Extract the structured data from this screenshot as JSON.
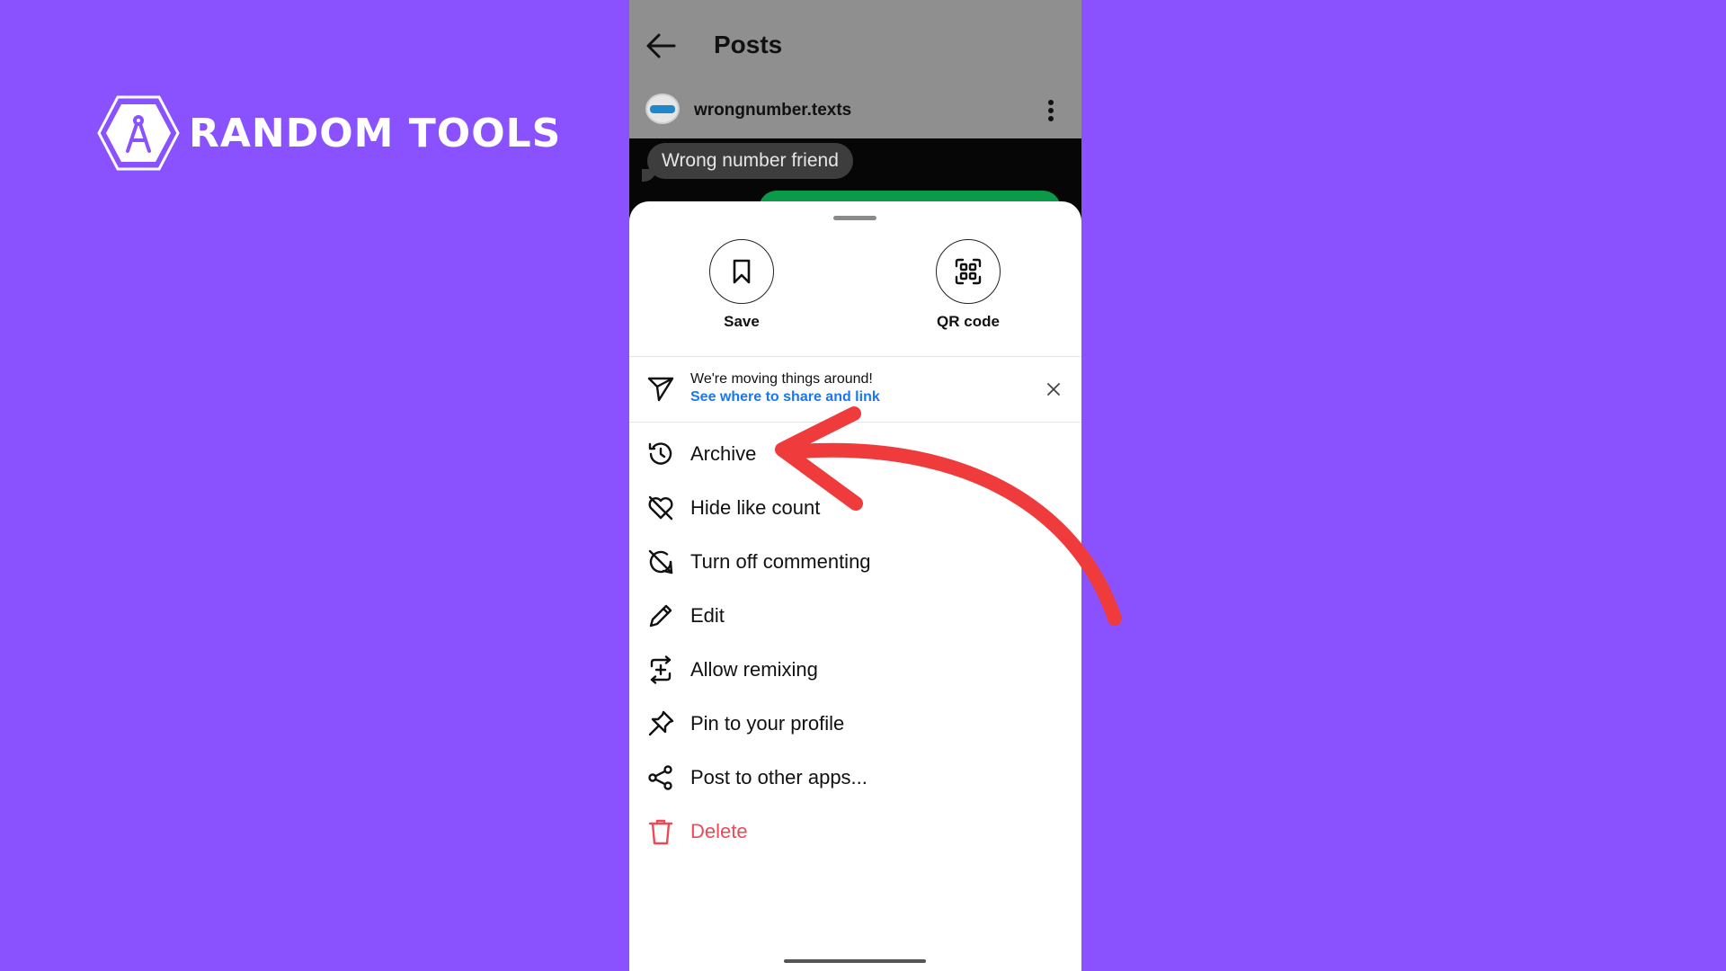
{
  "brand": {
    "name": "RANDOM TOOLS"
  },
  "header": {
    "title": "Posts"
  },
  "post": {
    "username": "wrongnumber.texts",
    "message_bubble": "Wrong number friend"
  },
  "sheet": {
    "quick_actions": [
      {
        "label": "Save",
        "icon": "bookmark-icon"
      },
      {
        "label": "QR code",
        "icon": "qr-code-icon"
      }
    ],
    "notice": {
      "title": "We're moving things around!",
      "link": "See where to share and link",
      "icon": "paper-plane-icon"
    },
    "menu": [
      {
        "label": "Archive",
        "icon": "archive-history-icon"
      },
      {
        "label": "Hide like count",
        "icon": "heart-slash-icon"
      },
      {
        "label": "Turn off commenting",
        "icon": "comment-off-icon"
      },
      {
        "label": "Edit",
        "icon": "pencil-icon"
      },
      {
        "label": "Allow remixing",
        "icon": "remix-icon"
      },
      {
        "label": "Pin to your profile",
        "icon": "pin-icon"
      },
      {
        "label": "Post to other apps...",
        "icon": "share-nodes-icon"
      },
      {
        "label": "Delete",
        "icon": "trash-icon",
        "danger": true
      }
    ]
  },
  "colors": {
    "background": "#8a52ff",
    "danger": "#ed4956",
    "link": "#1877f2",
    "annotation_arrow": "#ef3b3b"
  }
}
